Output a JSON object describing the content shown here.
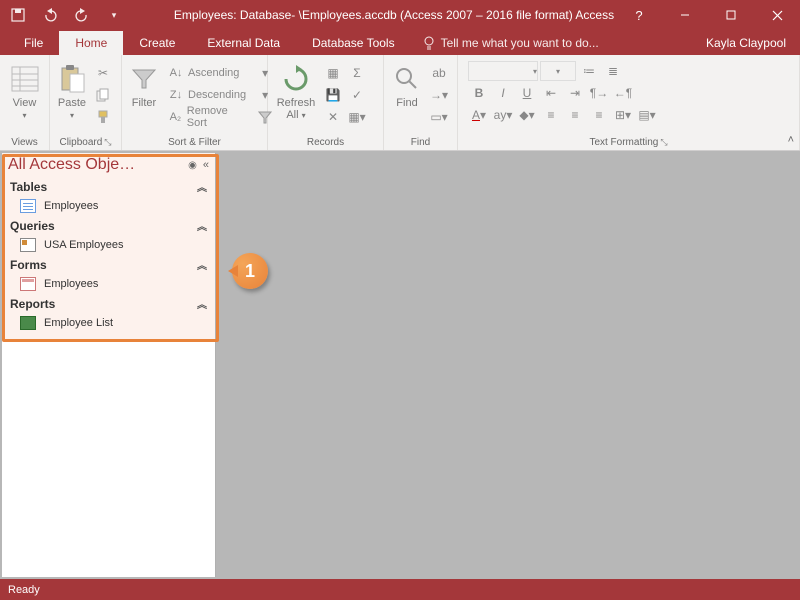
{
  "title": "Employees: Database- \\Employees.accdb (Access 2007 – 2016 file format) Access",
  "user": "Kayla Claypool",
  "tabs": {
    "file": "File",
    "home": "Home",
    "create": "Create",
    "external": "External Data",
    "dbtools": "Database Tools",
    "tellme": "Tell me what you want to do..."
  },
  "ribbon": {
    "views": {
      "label": "Views",
      "view": "View"
    },
    "clipboard": {
      "label": "Clipboard",
      "paste": "Paste"
    },
    "sortfilter": {
      "label": "Sort & Filter",
      "filter": "Filter",
      "asc": "Ascending",
      "desc": "Descending",
      "remove": "Remove Sort"
    },
    "records": {
      "label": "Records",
      "refresh": "Refresh All"
    },
    "find": {
      "label": "Find",
      "find": "Find"
    },
    "textfmt": {
      "label": "Text Formatting"
    }
  },
  "nav": {
    "title": "All Access Obje…",
    "cats": [
      {
        "name": "Tables",
        "items": [
          "Employees"
        ]
      },
      {
        "name": "Queries",
        "items": [
          "USA Employees"
        ]
      },
      {
        "name": "Forms",
        "items": [
          "Employees"
        ]
      },
      {
        "name": "Reports",
        "items": [
          "Employee List"
        ]
      }
    ]
  },
  "status": "Ready",
  "callout": "1"
}
